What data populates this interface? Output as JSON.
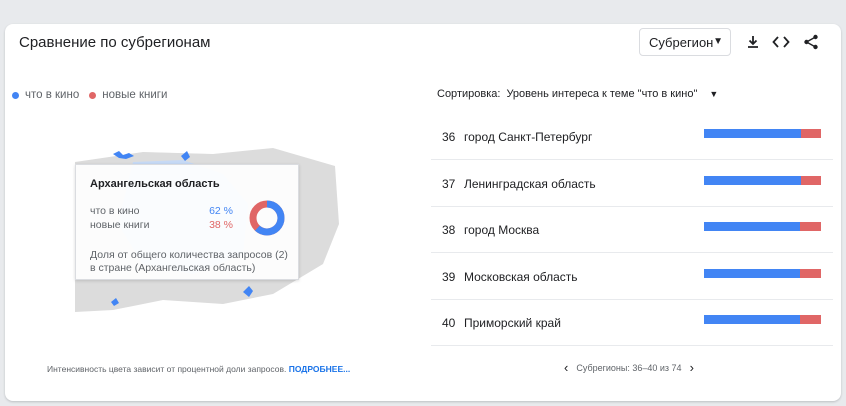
{
  "header": {
    "title": "Сравнение по субрегионам",
    "dropdown_label": "Субрегион",
    "icons": [
      "download-icon",
      "embed-code-icon",
      "share-icon"
    ]
  },
  "legend": [
    {
      "label": "что в кино",
      "color": "#4285f4"
    },
    {
      "label": "новые книги",
      "color": "#e06666"
    }
  ],
  "tooltip": {
    "title": "Архангельская область",
    "rows": [
      {
        "label": "что в кино",
        "value": "62 %",
        "color": "#4285f4"
      },
      {
        "label": "новые книги",
        "value": "38 %",
        "color": "#e06666"
      }
    ],
    "share": 0.62,
    "note": "Доля от общего количества запросов (2) в стране (Архангельская область)"
  },
  "sort": {
    "label": "Сортировка:",
    "value": "Уровень интереса к теме \"что в кино\""
  },
  "regions": [
    {
      "rank": "36",
      "name": "город Санкт-Петербург",
      "share_a": 0.83
    },
    {
      "rank": "37",
      "name": "Ленинградская область",
      "share_a": 0.83
    },
    {
      "rank": "38",
      "name": "город Москва",
      "share_a": 0.82
    },
    {
      "rank": "39",
      "name": "Московская область",
      "share_a": 0.82
    },
    {
      "rank": "40",
      "name": "Приморский край",
      "share_a": 0.82
    }
  ],
  "footnote": {
    "text": "Интенсивность цвета зависит от процентной доли запросов.",
    "link": "ПОДРОБНЕЕ..."
  },
  "pager": {
    "text": "Субрегионы: 36–40 из 74"
  },
  "colors": {
    "series_a": "#4285f4",
    "series_b": "#e06666"
  }
}
